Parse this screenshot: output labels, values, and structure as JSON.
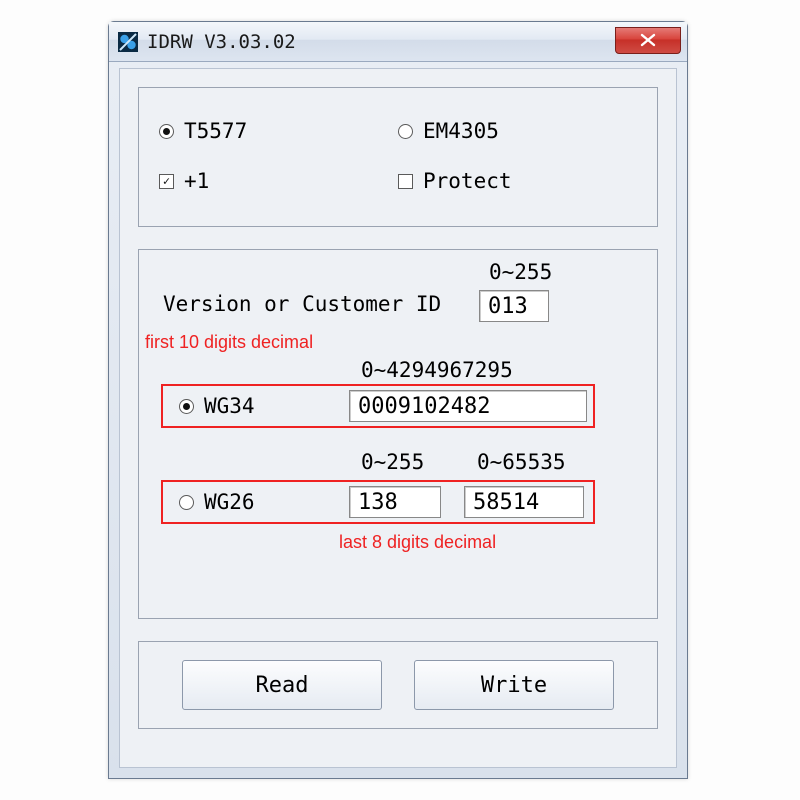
{
  "window": {
    "title": "IDRW V3.03.02"
  },
  "chipType": {
    "t5577_label": "T5577",
    "em4305_label": "EM4305",
    "selected": "T5577"
  },
  "options": {
    "plus1_label": "+1",
    "plus1_checked": true,
    "protect_label": "Protect",
    "protect_checked": false
  },
  "customerId": {
    "range_hint": "0~255",
    "label": "Version or Customer ID",
    "value": "013"
  },
  "wg34": {
    "label": "WG34",
    "range_hint": "0~4294967295",
    "value": "0009102482"
  },
  "wg26": {
    "label": "WG26",
    "rangeA": "0~255",
    "rangeB": "0~65535",
    "valueA": "138",
    "valueB": "58514"
  },
  "wgSelected": "WG34",
  "buttons": {
    "read": "Read",
    "write": "Write"
  },
  "annotations": {
    "first10": "first 10 digits decimal",
    "last8": "last 8 digits decimal"
  }
}
